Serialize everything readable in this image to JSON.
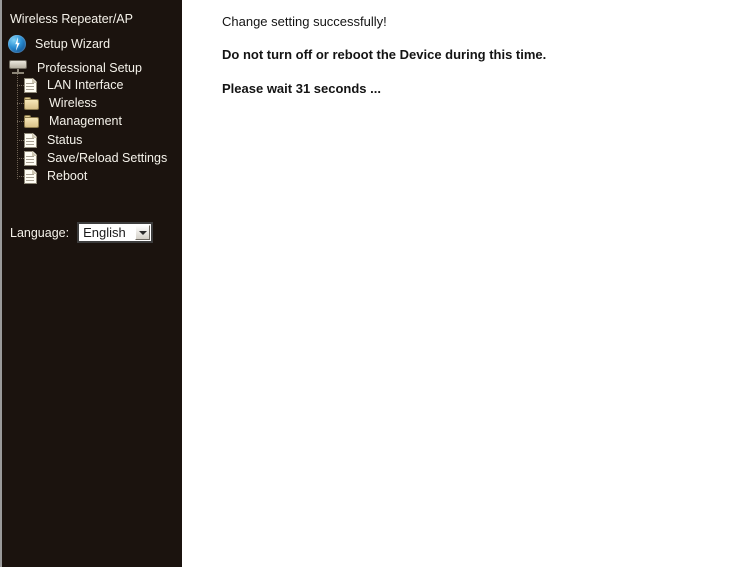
{
  "sidebar": {
    "brand_title": "Wireless Repeater/AP",
    "wizard": {
      "label": "Setup Wizard",
      "icon": "wizard-bolt-icon"
    },
    "professional": {
      "label": "Professional Setup",
      "icon": "device-icon"
    },
    "items": [
      {
        "label": "LAN Interface",
        "icon": "document-icon"
      },
      {
        "label": "Wireless",
        "icon": "folder-icon"
      },
      {
        "label": "Management",
        "icon": "folder-icon"
      },
      {
        "label": "Status",
        "icon": "document-icon"
      },
      {
        "label": "Save/Reload Settings",
        "icon": "document-icon"
      },
      {
        "label": "Reboot",
        "icon": "document-icon"
      }
    ],
    "language": {
      "label": "Language:",
      "selected": "English",
      "options": [
        "English"
      ],
      "arrow_icon": "chevron-down-icon"
    },
    "background_color": "#1b130e",
    "text_color": "#f5f2ea"
  },
  "content": {
    "success_message": "Change setting successfully!",
    "warning_message": "Do not turn off or reboot the Device during this time.",
    "wait_message": "Please wait 31 seconds ...",
    "background_color": "#ffffff",
    "text_color": "#141414"
  }
}
